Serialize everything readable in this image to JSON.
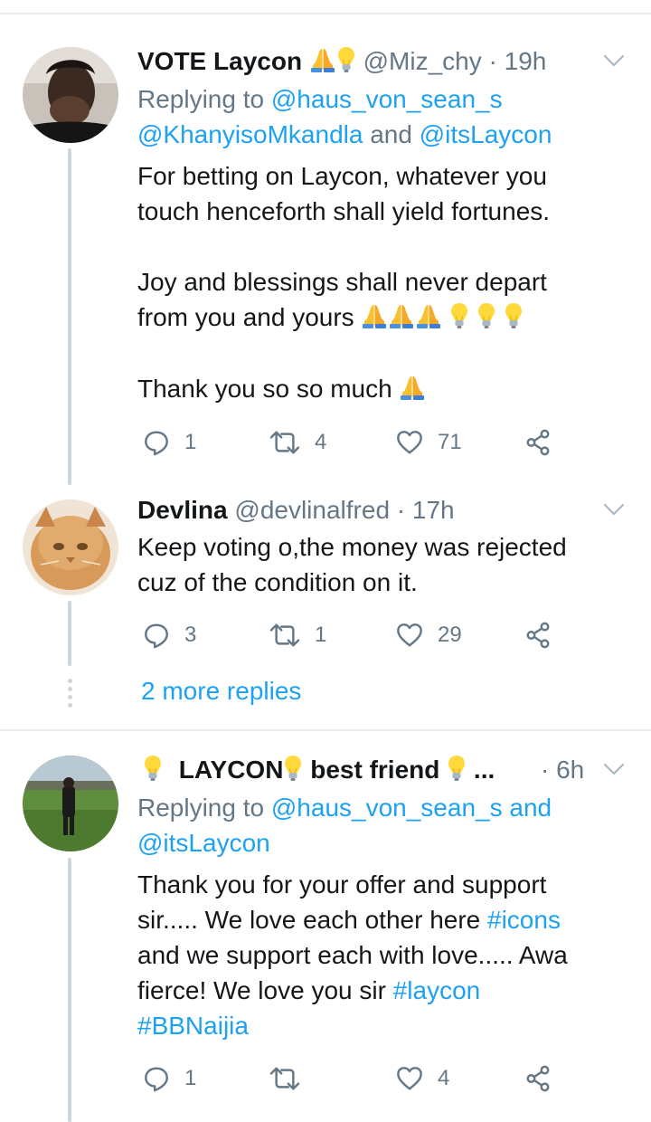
{
  "tweets": [
    {
      "name": "VOTE Laycon",
      "handle": "@Miz_chy",
      "time": "· 19h",
      "reply_prefix": "Replying to",
      "reply_users": [
        "@haus_von_sean_s",
        "@KhanyisoMkandla",
        "@itsLaycon"
      ],
      "reply_and": "and",
      "lines": [
        "For betting on Laycon, whatever you",
        "touch henceforth shall yield fortunes.",
        "Joy and blessings shall never depart",
        "from you and yours",
        "Thank you so so much"
      ],
      "replies": "1",
      "retweets": "4",
      "likes": "71",
      "name_emojis": [
        "folded-hands-icon",
        "light-bulb-icon"
      ]
    },
    {
      "name": "Devlina",
      "handle": "@devlinalfred",
      "time": "· 17h",
      "lines": [
        "Keep voting o,the money was rejected",
        "cuz of the condition on it."
      ],
      "replies": "3",
      "retweets": "1",
      "likes": "29"
    },
    {
      "name_part1": "LAYCON",
      "name_part2": "best friend",
      "name_ellipsis": "...",
      "time": "· 6h",
      "reply_prefix": "Replying to",
      "reply_users": [
        "@haus_von_sean_s",
        "@itsLaycon"
      ],
      "reply_and": "and",
      "line1": "Thank you for your offer and support",
      "line2_text": "sir..... We love each other here ",
      "hashtag1": "#icons",
      "line3": "and we support each with love..... Awa",
      "line4_text": "fierce! We love you sir ",
      "hashtag2": "#laycon",
      "hashtag3": "#BBNaijia",
      "replies": "1",
      "retweets": "",
      "likes": "4"
    }
  ],
  "more_replies": "2 more replies",
  "colors": {
    "link": "#1da1f2",
    "muted": "#657786",
    "divider": "#e6ecf0",
    "thread": "#ccd6dd"
  }
}
